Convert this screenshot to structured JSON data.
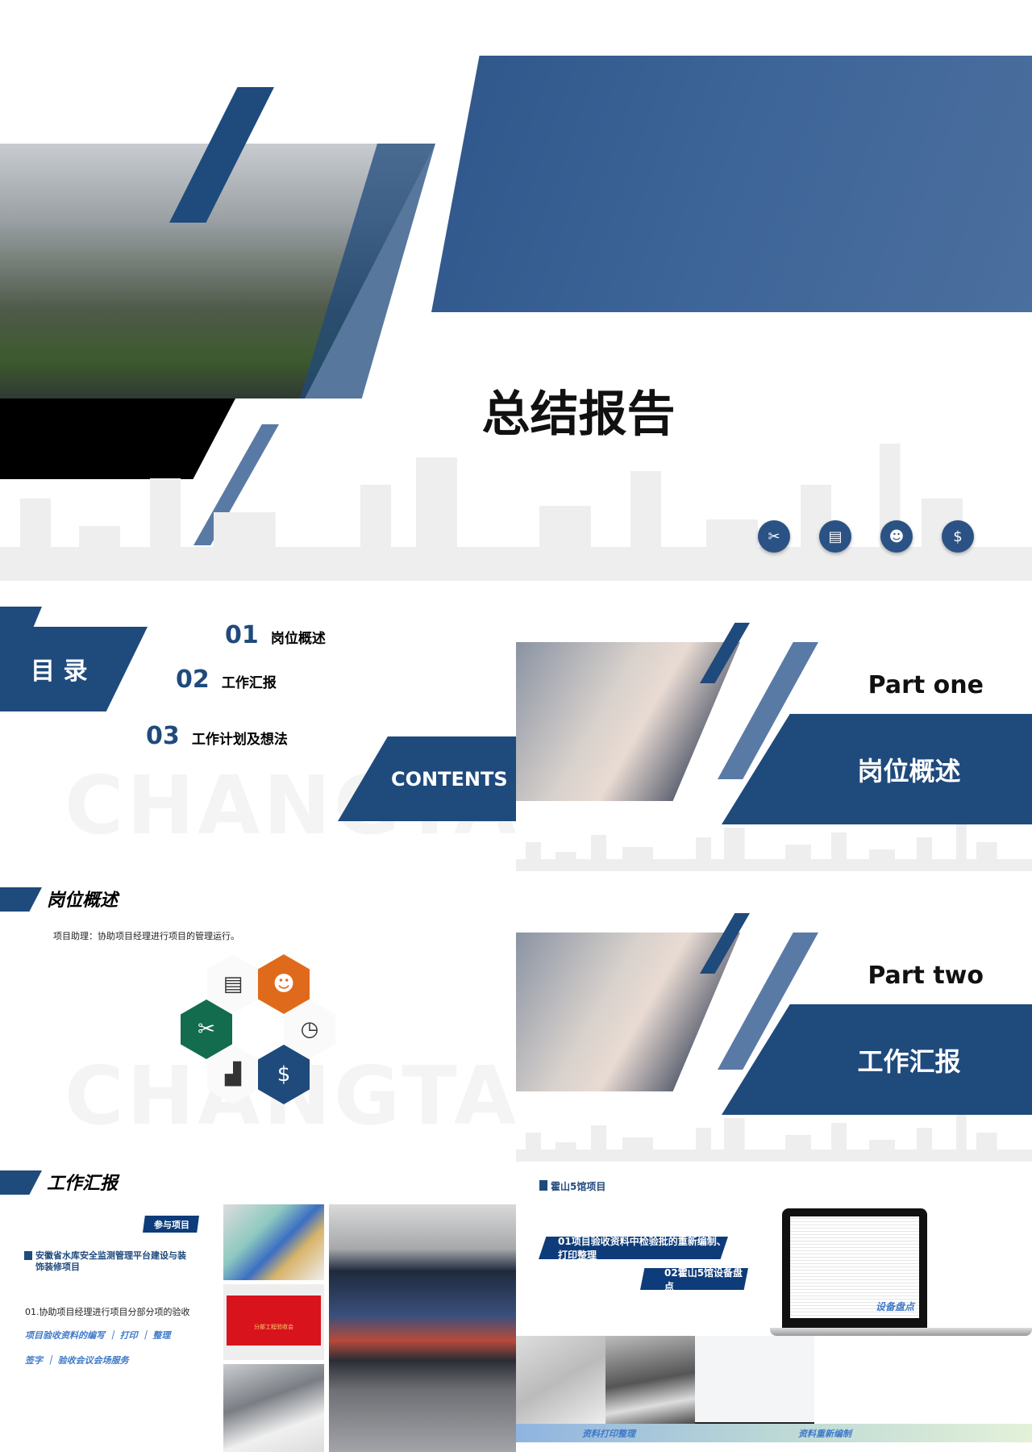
{
  "cover": {
    "title": "总结报告",
    "icons": [
      "tools-icon",
      "clipboard-icon",
      "team-icon",
      "coins-icon"
    ]
  },
  "contents": {
    "heading": "目 录",
    "items": [
      {
        "num": "01",
        "label": "岗位概述"
      },
      {
        "num": "02",
        "label": "工作汇报"
      },
      {
        "num": "03",
        "label": "工作计划及想法"
      }
    ],
    "badge": "CONTENTS",
    "watermark": "CHANGTAI"
  },
  "part_one": {
    "part": "Part one",
    "title": "岗位概述"
  },
  "overview": {
    "title": "岗位概述",
    "description": "项目助理：协助项目经理进行项目的管理运行。",
    "watermark": "CHANGTAI",
    "hex_colors": {
      "orange": "#e06a1b",
      "green": "#136c4e",
      "navy": "#1f4a7c"
    }
  },
  "part_two": {
    "part": "Part two",
    "title": "工作汇报"
  },
  "report": {
    "title": "工作汇报",
    "tag": "参与项目",
    "project": "安徽省水库安全监测管理平台建设与装饰装修项目",
    "task": "01.协助项目经理进行项目分部分项的验收",
    "line1": "项目验收资料的编写 ｜ 打印 ｜ 整理",
    "line2": "签字 ｜ 验收会议会场服务",
    "screen_title": "分部工程验收会"
  },
  "huoshan": {
    "title": "霍山5馆项目",
    "item1": "01项目验收资料中检验批的重新编制、打印整理",
    "item2": "02霍山5馆设备盘点",
    "laptop_caption": "设备盘点",
    "caption1": "资料打印整理",
    "caption2": "资料重新编制"
  },
  "colors": {
    "primary": "#1f4a7c",
    "accent": "#3e79c9"
  }
}
